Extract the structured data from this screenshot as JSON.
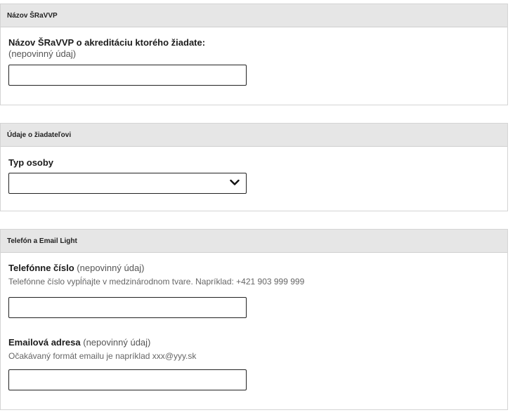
{
  "sections": {
    "srawp": {
      "header": "Názov ŠRaVVP",
      "field_label": "Názov ŠRaVVP o akreditáciu ktorého žiadate:",
      "optional_note": "(nepovinný údaj)",
      "value": ""
    },
    "applicant": {
      "header": "Údaje o žiadateľovi",
      "field_label": "Typ osoby",
      "selected": ""
    },
    "contact": {
      "header": "Telefón a Email Light",
      "phone_label": "Telefónne číslo",
      "phone_optional": "(nepovinný údaj)",
      "phone_hint": "Telefónne číslo vypĺňajte v medzinárodnom tvare. Napríklad: +421 903 999 999",
      "phone_value": "",
      "email_label": "Emailová adresa",
      "email_optional": "(nepovinný údaj)",
      "email_hint": "Očakávaný formát emailu je napríklad xxx@yyy.sk",
      "email_value": ""
    }
  },
  "icons": {
    "select_toggle": "chevron-down-icon"
  }
}
